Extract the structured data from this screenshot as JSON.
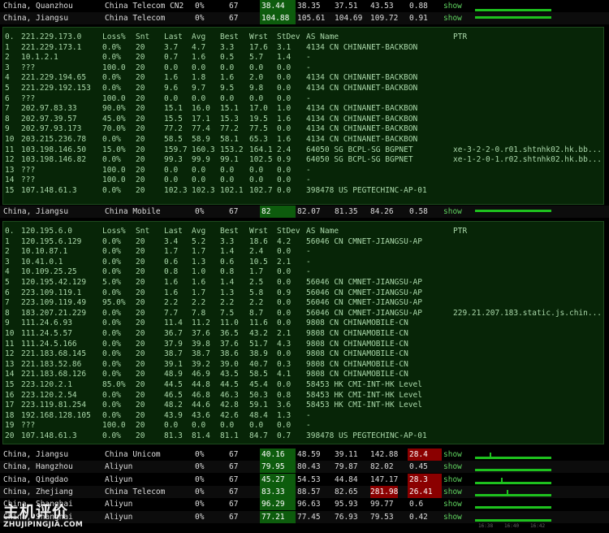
{
  "top_rows": [
    {
      "loc": "China, Quanzhou",
      "isp": "China Telecom CN2",
      "loss": "0%",
      "snt": "67",
      "v1": "38.44",
      "v2": "38.35",
      "v3": "37.51",
      "v4": "43.53",
      "v5": "0.88",
      "show": "show"
    },
    {
      "loc": "China, Jiangsu",
      "isp": "China Telecom",
      "loss": "0%",
      "snt": "67",
      "v1": "104.88",
      "v2": "105.61",
      "v3": "104.69",
      "v4": "109.72",
      "v5": "0.91",
      "show": "show"
    }
  ],
  "trace1": {
    "header": [
      "0.",
      "221.229.173.0",
      "Loss%",
      "Snt",
      "Last",
      "Avg",
      "Best",
      "Wrst",
      "StDev",
      "AS Name",
      "PTR"
    ],
    "rows": [
      [
        "1",
        "221.229.173.1",
        "0.0%",
        "20",
        "3.7",
        "4.7",
        "3.3",
        "17.6",
        "3.1",
        "4134  CN CHINANET-BACKBON",
        ""
      ],
      [
        "2",
        "10.1.2.1",
        "0.0%",
        "20",
        "0.7",
        "1.6",
        "0.5",
        "5.7",
        "1.4",
        "-",
        ""
      ],
      [
        "3",
        "???",
        "100.0",
        "20",
        "0.0",
        "0.0",
        "0.0",
        "0.0",
        "0.0",
        "-",
        ""
      ],
      [
        "4",
        "221.229.194.65",
        "0.0%",
        "20",
        "1.6",
        "1.8",
        "1.6",
        "2.0",
        "0.0",
        "4134  CN CHINANET-BACKBON",
        ""
      ],
      [
        "5",
        "221.229.192.153",
        "0.0%",
        "20",
        "9.6",
        "9.7",
        "9.5",
        "9.8",
        "0.0",
        "4134  CN CHINANET-BACKBON",
        ""
      ],
      [
        "6",
        "???",
        "100.0",
        "20",
        "0.0",
        "0.0",
        "0.0",
        "0.0",
        "0.0",
        "-",
        ""
      ],
      [
        "7",
        "202.97.83.33",
        "90.0%",
        "20",
        "15.1",
        "16.0",
        "15.1",
        "17.0",
        "1.0",
        "4134  CN CHINANET-BACKBON",
        ""
      ],
      [
        "8",
        "202.97.39.57",
        "45.0%",
        "20",
        "15.5",
        "17.1",
        "15.3",
        "19.5",
        "1.6",
        "4134  CN CHINANET-BACKBON",
        ""
      ],
      [
        "9",
        "202.97.93.173",
        "70.0%",
        "20",
        "77.2",
        "77.4",
        "77.2",
        "77.5",
        "0.0",
        "4134  CN CHINANET-BACKBON",
        ""
      ],
      [
        "10",
        "203.215.236.78",
        "0.0%",
        "20",
        "58.5",
        "58.9",
        "58.1",
        "65.3",
        "1.6",
        "4134  CN CHINANET-BACKBON",
        ""
      ],
      [
        "11",
        "103.198.146.50",
        "15.0%",
        "20",
        "159.7",
        "160.3",
        "153.2",
        "164.1",
        "2.4",
        "64050 SG BCPL-SG BGPNET",
        "xe-3-2-2-0.r01.shtnhk02.hk.bb..."
      ],
      [
        "12",
        "103.198.146.82",
        "0.0%",
        "20",
        "99.3",
        "99.9",
        "99.1",
        "102.5",
        "0.9",
        "64050 SG BCPL-SG BGPNET",
        "xe-1-2-0-1.r02.shtnhk02.hk.bb..."
      ],
      [
        "13",
        "???",
        "100.0",
        "20",
        "0.0",
        "0.0",
        "0.0",
        "0.0",
        "0.0",
        "-",
        ""
      ],
      [
        "14",
        "???",
        "100.0",
        "20",
        "0.0",
        "0.0",
        "0.0",
        "0.0",
        "0.0",
        "-",
        ""
      ],
      [
        "15",
        "107.148.61.3",
        "0.0%",
        "20",
        "102.3",
        "102.3",
        "102.1",
        "102.7",
        "0.0",
        "398478 US PEGTECHINC-AP-01",
        ""
      ]
    ]
  },
  "mid_row": {
    "loc": "China, Jiangsu",
    "isp": "China Mobile",
    "loss": "0%",
    "snt": "67",
    "v1": "82",
    "v2": "82.07",
    "v3": "81.35",
    "v4": "84.26",
    "v5": "0.58",
    "show": "show"
  },
  "trace2": {
    "header": [
      "0.",
      "120.195.6.0",
      "Loss%",
      "Snt",
      "Last",
      "Avg",
      "Best",
      "Wrst",
      "StDev",
      "AS Name",
      "PTR"
    ],
    "rows": [
      [
        "1",
        "120.195.6.129",
        "0.0%",
        "20",
        "3.4",
        "5.2",
        "3.3",
        "18.6",
        "4.2",
        "56046 CN CMNET-JIANGSU-AP",
        ""
      ],
      [
        "2",
        "10.10.87.1",
        "0.0%",
        "20",
        "1.7",
        "1.7",
        "1.4",
        "2.4",
        "0.0",
        "-",
        ""
      ],
      [
        "3",
        "10.41.0.1",
        "0.0%",
        "20",
        "0.6",
        "1.3",
        "0.6",
        "10.5",
        "2.1",
        "-",
        ""
      ],
      [
        "4",
        "10.109.25.25",
        "0.0%",
        "20",
        "0.8",
        "1.0",
        "0.8",
        "1.7",
        "0.0",
        "-",
        ""
      ],
      [
        "5",
        "120.195.42.129",
        "5.0%",
        "20",
        "1.6",
        "1.6",
        "1.4",
        "2.5",
        "0.0",
        "56046 CN CMNET-JIANGSU-AP",
        ""
      ],
      [
        "6",
        "223.109.119.1",
        "0.0%",
        "20",
        "1.6",
        "1.7",
        "1.3",
        "5.8",
        "0.9",
        "56046 CN CMNET-JIANGSU-AP",
        ""
      ],
      [
        "7",
        "223.109.119.49",
        "95.0%",
        "20",
        "2.2",
        "2.2",
        "2.2",
        "2.2",
        "0.0",
        "56046 CN CMNET-JIANGSU-AP",
        ""
      ],
      [
        "8",
        "183.207.21.229",
        "0.0%",
        "20",
        "7.7",
        "7.8",
        "7.5",
        "8.7",
        "0.0",
        "56046 CN CMNET-JIANGSU-AP",
        "229.21.207.183.static.js.chin..."
      ],
      [
        "9",
        "111.24.6.93",
        "0.0%",
        "20",
        "11.4",
        "11.2",
        "11.0",
        "11.6",
        "0.0",
        "9808  CN CHINAMOBILE-CN",
        ""
      ],
      [
        "10",
        "111.24.5.57",
        "0.0%",
        "20",
        "36.7",
        "37.6",
        "36.5",
        "43.2",
        "2.1",
        "9808  CN CHINAMOBILE-CN",
        ""
      ],
      [
        "11",
        "111.24.5.166",
        "0.0%",
        "20",
        "37.9",
        "39.8",
        "37.6",
        "51.7",
        "4.3",
        "9808  CN CHINAMOBILE-CN",
        ""
      ],
      [
        "12",
        "221.183.68.145",
        "0.0%",
        "20",
        "38.7",
        "38.7",
        "38.6",
        "38.9",
        "0.0",
        "9808  CN CHINAMOBILE-CN",
        ""
      ],
      [
        "13",
        "221.183.52.86",
        "0.0%",
        "20",
        "39.1",
        "39.2",
        "39.0",
        "40.7",
        "0.3",
        "9808  CN CHINAMOBILE-CN",
        ""
      ],
      [
        "14",
        "221.183.68.126",
        "0.0%",
        "20",
        "48.9",
        "46.9",
        "43.5",
        "58.5",
        "4.1",
        "9808  CN CHINAMOBILE-CN",
        ""
      ],
      [
        "15",
        "223.120.2.1",
        "85.0%",
        "20",
        "44.5",
        "44.8",
        "44.5",
        "45.4",
        "0.0",
        "58453 HK CMI-INT-HK Level",
        ""
      ],
      [
        "16",
        "223.120.2.54",
        "0.0%",
        "20",
        "46.5",
        "46.8",
        "46.3",
        "50.3",
        "0.8",
        "58453 HK CMI-INT-HK Level",
        ""
      ],
      [
        "17",
        "223.119.81.254",
        "0.0%",
        "20",
        "48.2",
        "44.6",
        "42.8",
        "59.1",
        "3.6",
        "58453 HK CMI-INT-HK Level",
        ""
      ],
      [
        "18",
        "192.168.128.105",
        "0.0%",
        "20",
        "43.9",
        "43.6",
        "42.6",
        "48.4",
        "1.3",
        "-",
        ""
      ],
      [
        "19",
        "???",
        "100.0",
        "20",
        "0.0",
        "0.0",
        "0.0",
        "0.0",
        "0.0",
        "-",
        ""
      ],
      [
        "20",
        "107.148.61.3",
        "0.0%",
        "20",
        "81.3",
        "81.4",
        "81.1",
        "84.7",
        "0.7",
        "398478 US PEGTECHINC-AP-01",
        ""
      ]
    ]
  },
  "bottom_rows": [
    {
      "loc": "China, Jiangsu",
      "isp": "China Unicom",
      "loss": "0%",
      "snt": "67",
      "v1": "40.16",
      "v2": "48.59",
      "v3": "39.11",
      "v4": "142.88",
      "v5": "28.4",
      "show": "show",
      "v5_style": "red"
    },
    {
      "loc": "China, Hangzhou",
      "isp": "Aliyun",
      "loss": "0%",
      "snt": "67",
      "v1": "79.95",
      "v2": "80.43",
      "v3": "79.87",
      "v4": "82.02",
      "v5": "0.45",
      "show": "show",
      "v5_style": ""
    },
    {
      "loc": "China, Qingdao",
      "isp": "Aliyun",
      "loss": "0%",
      "snt": "67",
      "v1": "45.27",
      "v2": "54.53",
      "v3": "44.84",
      "v4": "147.17",
      "v5": "28.3",
      "show": "show",
      "v5_style": "red"
    },
    {
      "loc": "China, Zhejiang",
      "isp": "China Telecom",
      "loss": "0%",
      "snt": "67",
      "v1": "83.33",
      "v2": "88.57",
      "v3": "82.65",
      "v4": "281.98",
      "v5": "26.41",
      "show": "show",
      "v5_style": "red",
      "v4_style": "red"
    },
    {
      "loc": "China, Shanghai",
      "isp": "Aliyun",
      "loss": "0%",
      "snt": "67",
      "v1": "96.29",
      "v2": "96.63",
      "v3": "95.93",
      "v4": "99.77",
      "v5": "0.6",
      "show": "show",
      "v5_style": ""
    },
    {
      "loc": "China, Shanghai",
      "isp": "Aliyun",
      "loss": "0%",
      "snt": "67",
      "v1": "77.21",
      "v2": "77.45",
      "v3": "76.93",
      "v4": "79.53",
      "v5": "0.42",
      "show": "show",
      "v5_style": ""
    }
  ],
  "mini_times": [
    "16:38",
    "16:40",
    "16:42"
  ],
  "watermark": {
    "main": "主机评价",
    "url": "ZHUJIPINGJIA.COM"
  }
}
